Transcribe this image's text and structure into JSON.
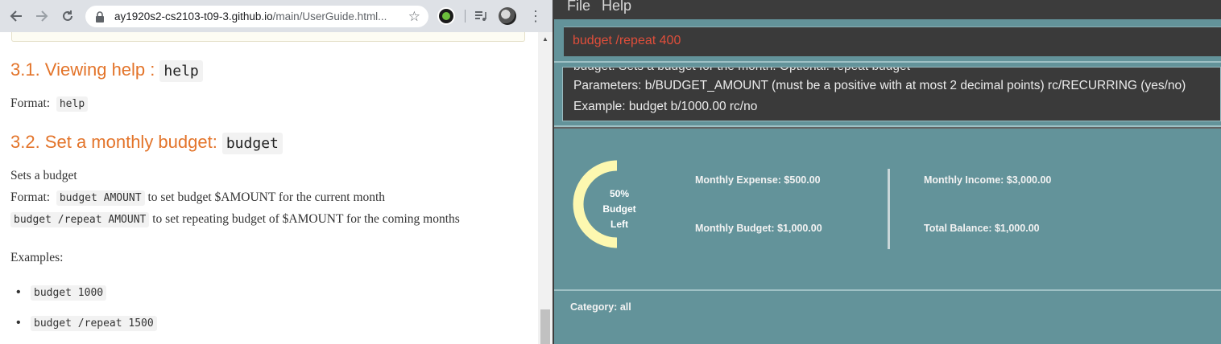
{
  "browser": {
    "url_host": "ay1920s2-cs2103-t09-3.github.io",
    "url_path": "/main/UserGuide.html..."
  },
  "doc": {
    "section_help": {
      "heading": "3.1. Viewing help :",
      "command": "help",
      "format_label": "Format:",
      "format_code": "help"
    },
    "section_budget": {
      "heading": "3.2. Set a monthly budget:",
      "command": "budget",
      "desc": "Sets a budget",
      "format_label": "Format:",
      "format_code": "budget AMOUNT",
      "format_text": "to set budget $AMOUNT for the current month",
      "repeat_code": "budget /repeat AMOUNT",
      "repeat_text": "to set repeating budget of $AMOUNT for the coming months",
      "examples_label": "Examples:",
      "examples": [
        "budget 1000",
        "budget /repeat 1500"
      ]
    }
  },
  "app": {
    "menu": [
      "File",
      "Help"
    ],
    "command_input": "budget /repeat 400",
    "result": {
      "cut_line": "budget: Sets a budget for the month. Optional: repeat budget",
      "line1": "Parameters: b/BUDGET_AMOUNT (must be a positive with at most 2 decimal points) rc/RECURRING (yes/no)",
      "line2": "Example: budget b/1000.00 rc/no"
    },
    "stats": {
      "budget_left_percent": 50,
      "donut_label_lines": [
        "50%",
        "Budget",
        "Left"
      ],
      "monthly_expense": "Monthly Expense: $500.00",
      "monthly_budget": "Monthly Budget: $1,000.00",
      "monthly_income": "Monthly Income: $3,000.00",
      "total_balance": "Total Balance: $1,000.00"
    },
    "category": "Category: all",
    "colors": {
      "teal": "#63939a",
      "donut": "#fdf8b0",
      "command_text": "#e04e3a",
      "heading": "#e3742a"
    }
  }
}
